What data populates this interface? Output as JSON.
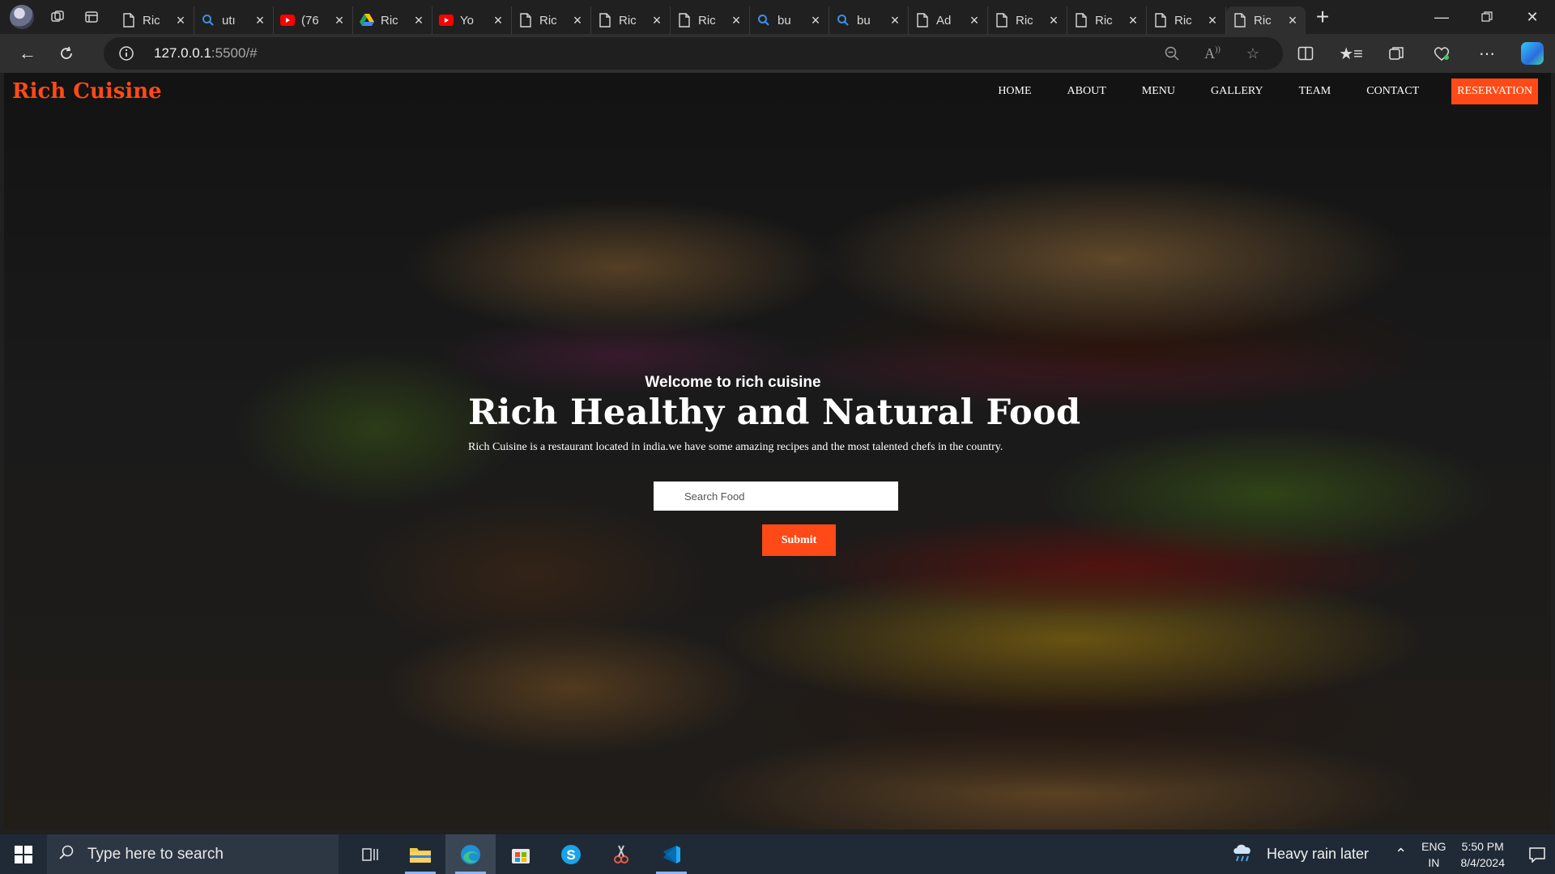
{
  "browser": {
    "tabs": [
      {
        "favicon": "page-icon",
        "label": "Ric"
      },
      {
        "favicon": "search-icon",
        "label": "utı"
      },
      {
        "favicon": "youtube-icon",
        "label": "(76"
      },
      {
        "favicon": "drive-icon",
        "label": "Ric"
      },
      {
        "favicon": "youtube-icon",
        "label": "Yo"
      },
      {
        "favicon": "page-icon",
        "label": "Ric"
      },
      {
        "favicon": "page-icon",
        "label": "Ric"
      },
      {
        "favicon": "page-icon",
        "label": "Ric"
      },
      {
        "favicon": "search-icon",
        "label": "bu"
      },
      {
        "favicon": "search-icon",
        "label": "bu"
      },
      {
        "favicon": "page-icon",
        "label": "Ad"
      },
      {
        "favicon": "page-icon",
        "label": "Ric"
      },
      {
        "favicon": "page-icon",
        "label": "Ric"
      },
      {
        "favicon": "page-icon",
        "label": "Ric"
      },
      {
        "favicon": "page-icon",
        "label": "Ric"
      }
    ],
    "active_tab_index": 14,
    "url_host": "127.0.0.1",
    "url_rest": ":5500/#"
  },
  "site": {
    "brand": "Rich Cuisine",
    "nav": {
      "home": "HOME",
      "about": "ABOUT",
      "menu": "MENU",
      "gallery": "GALLERY",
      "team": "TEAM",
      "contact": "CONTACT",
      "reservation": "RESERVATION"
    },
    "hero": {
      "welcome": "Welcome to rich cuisine",
      "headline": "Rich Healthy and Natural Food",
      "subtext": "Rich Cuisine is a restaurant located in india.we have some amazing recipes and the most talented chefs in the country.",
      "search_placeholder": "Search Food",
      "submit_label": "Submit"
    },
    "accent_color": "#ff4a17"
  },
  "taskbar": {
    "search_placeholder": "Type here to search",
    "weather": "Heavy rain later",
    "lang_line1": "ENG",
    "lang_line2": "IN",
    "time": "5:50 PM",
    "date": "8/4/2024"
  }
}
